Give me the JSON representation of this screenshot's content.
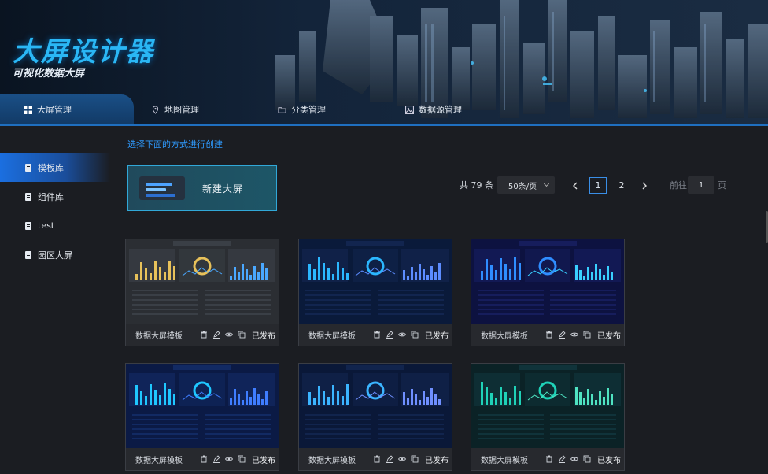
{
  "brand": {
    "title": "大屏设计器",
    "subtitle": "可视化数据大屏"
  },
  "top_tabs": [
    {
      "label": "大屏管理",
      "icon": "grid-icon",
      "active": true
    },
    {
      "label": "地图管理",
      "icon": "location-pin-icon",
      "active": false
    },
    {
      "label": "分类管理",
      "icon": "folder-icon",
      "active": false
    },
    {
      "label": "数据源管理",
      "icon": "image-icon",
      "active": false
    }
  ],
  "sidebar": {
    "items": [
      {
        "label": "模板库",
        "active": true
      },
      {
        "label": "组件库",
        "active": false
      },
      {
        "label": "test",
        "active": false
      },
      {
        "label": "园区大屏",
        "active": false
      }
    ]
  },
  "main": {
    "hint": "选择下面的方式进行创建",
    "new_button": "新建大屏",
    "pagination": {
      "total": "共 79 条",
      "page_size": "50条/页",
      "pages": [
        "1",
        "2"
      ],
      "current_page": "1",
      "goto_prefix": "前往",
      "goto_value": "1",
      "goto_suffix": "页"
    },
    "cards": [
      {
        "name": "数据大屏模板",
        "status": "已发布",
        "theme": "dark"
      },
      {
        "name": "数据大屏模板",
        "status": "已发布",
        "theme": "navy"
      },
      {
        "name": "数据大屏模板",
        "status": "已发布",
        "theme": "indigo"
      },
      {
        "name": "数据大屏模板",
        "status": "已发布",
        "theme": "navy2"
      },
      {
        "name": "数据大屏模板",
        "status": "已发布",
        "theme": "navy3"
      },
      {
        "name": "数据大屏模板",
        "status": "已发布",
        "theme": "teal"
      }
    ]
  },
  "colors": {
    "accent": "#2ab7f5",
    "primary": "#1b6fe0",
    "background": "#1b1d22"
  }
}
